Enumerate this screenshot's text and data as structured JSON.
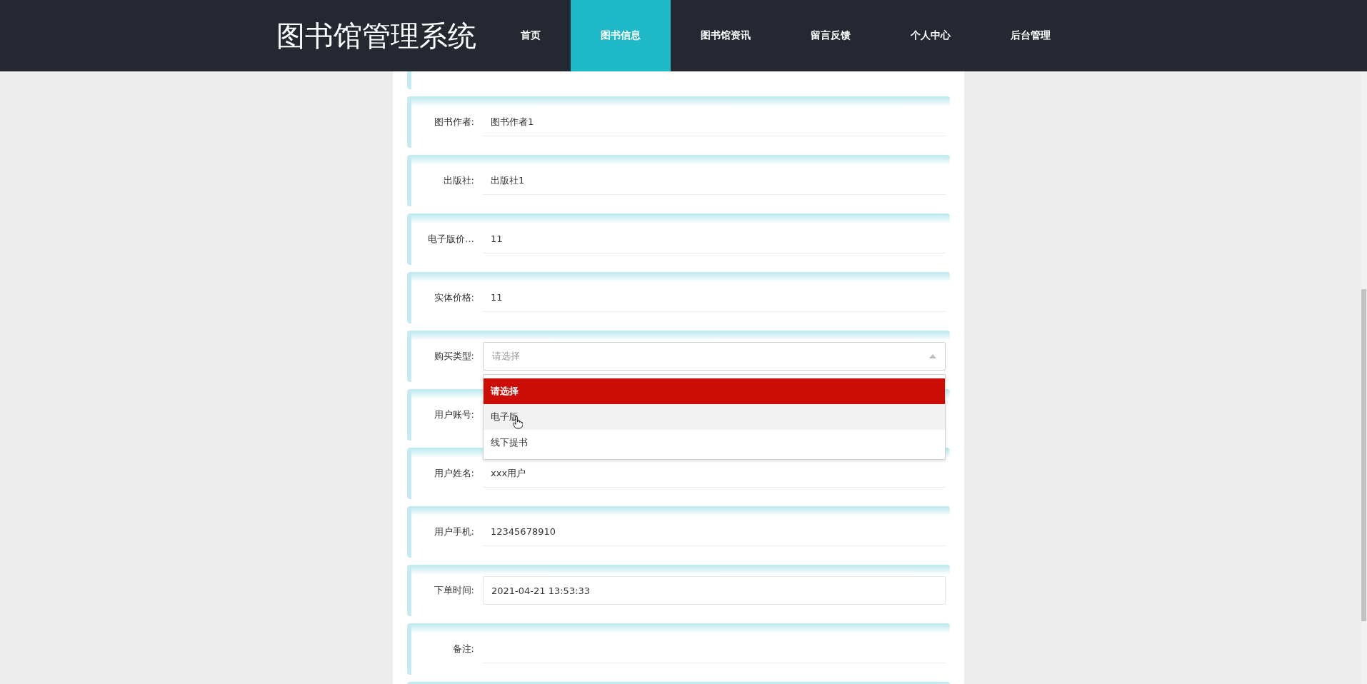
{
  "header": {
    "logo": "图书馆管理系统",
    "nav": [
      {
        "label": "首页",
        "selected": false
      },
      {
        "label": "图书信息",
        "selected": true
      },
      {
        "label": "图书馆资讯",
        "selected": false
      },
      {
        "label": "留言反馈",
        "selected": false
      },
      {
        "label": "个人中心",
        "selected": false
      },
      {
        "label": "后台管理",
        "selected": false
      }
    ]
  },
  "form": {
    "fields": [
      {
        "kind": "text",
        "label": "图书作者:",
        "value": "图书作者1"
      },
      {
        "kind": "text",
        "label": "出版社:",
        "value": "出版社1"
      },
      {
        "kind": "text",
        "label": "电子版价…",
        "value": "11"
      },
      {
        "kind": "text",
        "label": "实体价格:",
        "value": "11"
      },
      {
        "kind": "select",
        "label": "购买类型:",
        "placeholder": "请选择",
        "expanded": true,
        "options": [
          {
            "label": "请选择",
            "selected": true,
            "hovered": false
          },
          {
            "label": "电子版",
            "selected": false,
            "hovered": true
          },
          {
            "label": "线下提书",
            "selected": false,
            "hovered": false
          }
        ]
      },
      {
        "kind": "text",
        "label": "用户账号:"
      },
      {
        "kind": "text",
        "label": "用户姓名:",
        "value": "xxx用户"
      },
      {
        "kind": "text",
        "label": "用户手机:",
        "value": "12345678910"
      },
      {
        "kind": "date",
        "label": "下单时间:",
        "value": "2021-04-21 13:53:33"
      },
      {
        "kind": "text",
        "label": "备注:"
      }
    ]
  }
}
